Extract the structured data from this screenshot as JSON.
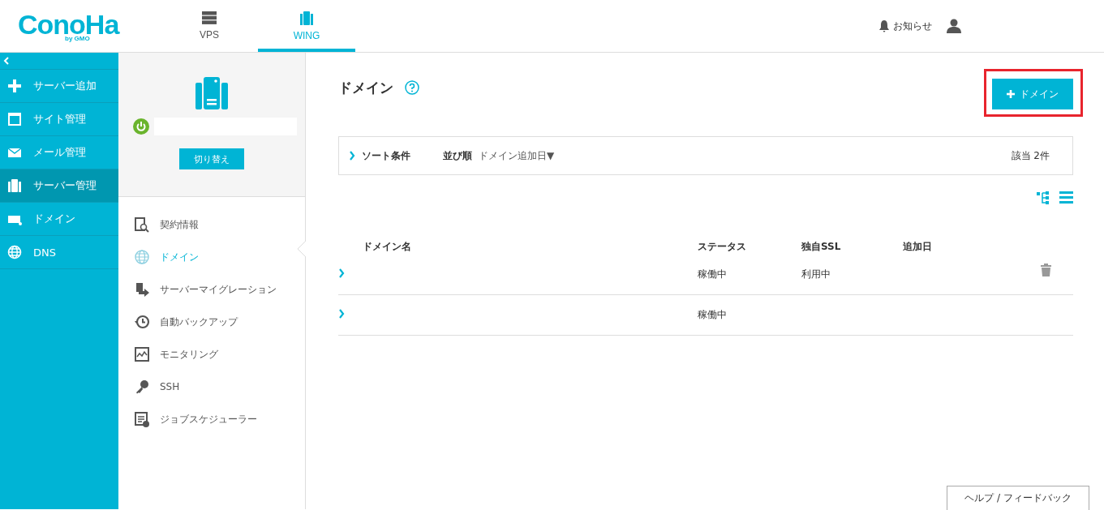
{
  "header": {
    "logo": "ConoHa",
    "logo_sub": "by GMO",
    "tabs": [
      {
        "label": "VPS",
        "selected": false
      },
      {
        "label": "WING",
        "selected": true
      }
    ],
    "notice": "お知らせ"
  },
  "sidebar": {
    "items": [
      {
        "label": "サーバー追加",
        "selected": false
      },
      {
        "label": "サイト管理",
        "selected": false
      },
      {
        "label": "メール管理",
        "selected": false
      },
      {
        "label": "サーバー管理",
        "selected": true
      },
      {
        "label": "ドメイン",
        "selected": false
      },
      {
        "label": "DNS",
        "selected": false
      }
    ]
  },
  "server_panel": {
    "on": true,
    "switch_button": "切り替え",
    "menu": [
      {
        "label": "契約情報",
        "selected": false
      },
      {
        "label": "ドメイン",
        "selected": true
      },
      {
        "label": "サーバーマイグレーション",
        "selected": false
      },
      {
        "label": "自動バックアップ",
        "selected": false
      },
      {
        "label": "モニタリング",
        "selected": false
      },
      {
        "label": "SSH",
        "selected": false
      },
      {
        "label": "ジョブスケジューラー",
        "selected": false
      }
    ]
  },
  "main": {
    "title": "ドメイン",
    "add_button": "ドメイン",
    "sort": {
      "label": "ソート条件",
      "order_label": "並び順",
      "order_value": "ドメイン追加日▼",
      "count": "該当 2件"
    },
    "table": {
      "columns": [
        "ドメイン名",
        "ステータス",
        "独自SSL",
        "追加日"
      ],
      "rows": [
        {
          "status": "稼働中",
          "ssl": "利用中",
          "deletable": true
        },
        {
          "status": "稼働中",
          "ssl": "",
          "deletable": false
        }
      ]
    },
    "help_button": "ヘルプ / フィードバック"
  }
}
